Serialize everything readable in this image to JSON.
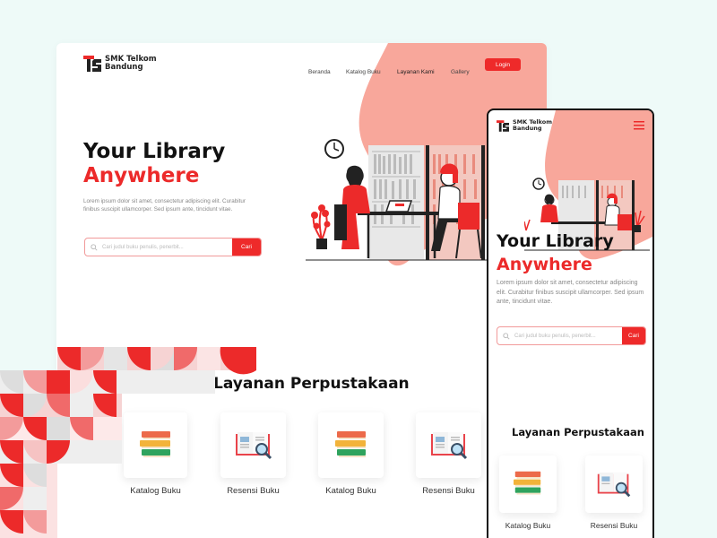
{
  "brand": {
    "line1": "SMK Telkom",
    "line2": "Bandung",
    "color": "#ec2a2a"
  },
  "nav": {
    "items": [
      "Beranda",
      "Katalog Buku",
      "Layanan Kami",
      "Gallery"
    ],
    "login": "Login"
  },
  "hero": {
    "title_line1": "Your Library",
    "title_line2": "Anywhere",
    "body": "Lorem ipsum dolor sit amet, consectetur adipiscing elit. Curabitur finibus suscipit ullamcorper. Sed ipsum ante, tincidunt vitae.",
    "search_placeholder": "Cari judul buku penulis, penerbit...",
    "search_button": "Cari"
  },
  "services": {
    "title": "Layanan Perpustakaan",
    "items": [
      "Katalog Buku",
      "Resensi Buku",
      "Katalog Buku",
      "Resensi Buku"
    ]
  },
  "mobile": {
    "brand_line1": "SMK Telkom",
    "brand_line2": "Bandung",
    "title_line1": "Your Library",
    "title_line2": "Anywhere",
    "body": "Lorem ipsum dolor sit amet, consectetur adipiscing elit. Curabitur finibus suscipit ullamcorper. Sed ipsum ante, tincidunt vitae.",
    "search_placeholder": "Cari judul buku penulis, penerbit...",
    "search_button": "Cari",
    "services_title": "Layanan Perpustakaan",
    "items": [
      "Katalog Buku",
      "Resensi Buku"
    ]
  },
  "colors": {
    "accent": "#ec2a2a",
    "blob": "#f8a79b",
    "background": "#eefaf8"
  },
  "icons": [
    "logo-icon",
    "search-icon",
    "book-stack-icon",
    "open-book-magnifier-icon",
    "hamburger-menu-icon",
    "clock-icon",
    "plant-icon"
  ]
}
